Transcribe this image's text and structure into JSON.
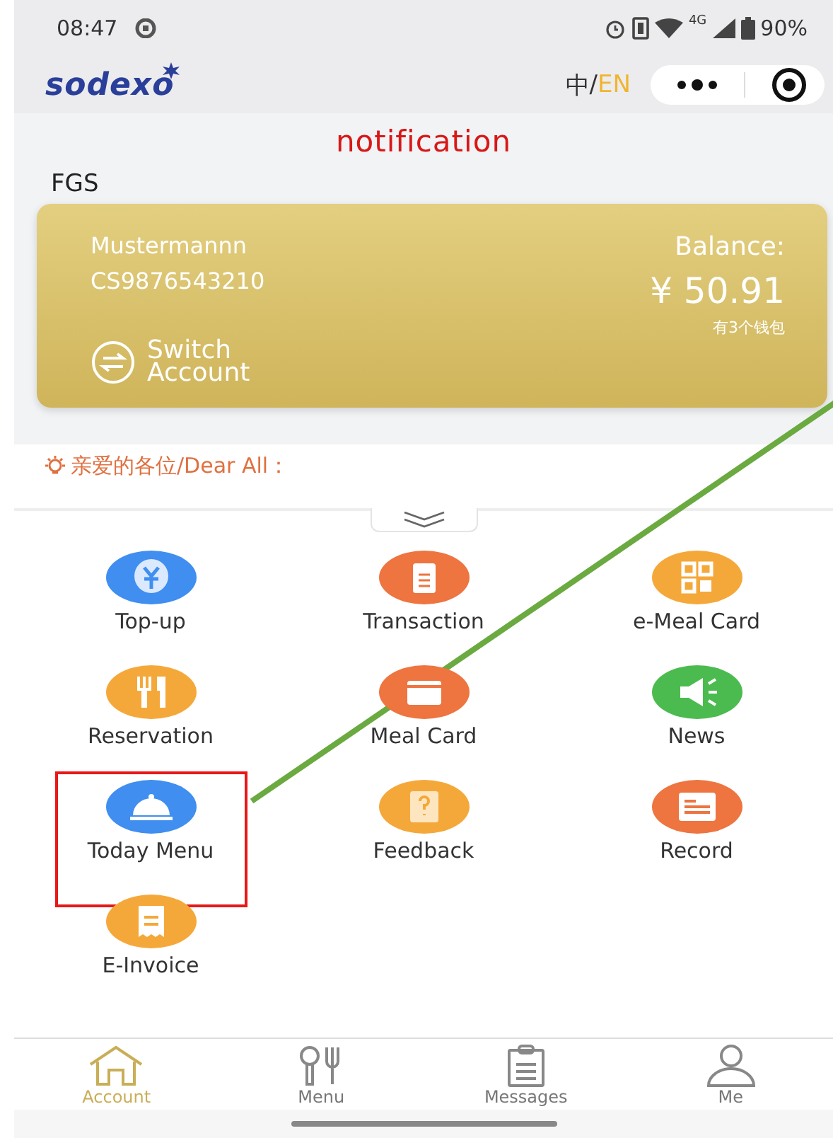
{
  "status_bar": {
    "time": "08:47",
    "network": "4G",
    "battery": "90%"
  },
  "header": {
    "logo": "sodexo",
    "language_separator": "/",
    "languages": [
      {
        "label": "中",
        "selected": false
      },
      {
        "label": "EN",
        "selected": true
      }
    ]
  },
  "page_title": "notification",
  "company": "FGS",
  "account_card": {
    "name": "Mustermannn",
    "card_number": "CS9876543210",
    "switch_label": "Switch Account",
    "balance_label": "Balance:",
    "balance": "¥ 50.91",
    "wallets": "有3个钱包"
  },
  "notice": "亲爱的各位/Dear All：",
  "tiles": [
    {
      "label": "Top-up",
      "kind": "topup",
      "highlighted": false
    },
    {
      "label": "Transaction",
      "kind": "transaction",
      "highlighted": false
    },
    {
      "label": "e-Meal Card",
      "kind": "qr",
      "highlighted": false
    },
    {
      "label": "Reservation",
      "kind": "reservation",
      "highlighted": false
    },
    {
      "label": "Meal Card",
      "kind": "card",
      "highlighted": false
    },
    {
      "label": "News",
      "kind": "news",
      "highlighted": false
    },
    {
      "label": "Today Menu",
      "kind": "menu",
      "highlighted": true
    },
    {
      "label": "Feedback",
      "kind": "feedback",
      "highlighted": false
    },
    {
      "label": "Record",
      "kind": "record",
      "highlighted": false
    },
    {
      "label": "E-Invoice",
      "kind": "invoice",
      "highlighted": false
    }
  ],
  "tab_bar": [
    {
      "label": "Account",
      "kind": "home",
      "selected": true
    },
    {
      "label": "Menu",
      "kind": "cutlery",
      "selected": false
    },
    {
      "label": "Messages",
      "kind": "clipboard",
      "selected": false
    },
    {
      "label": "Me",
      "kind": "person",
      "selected": false
    }
  ]
}
